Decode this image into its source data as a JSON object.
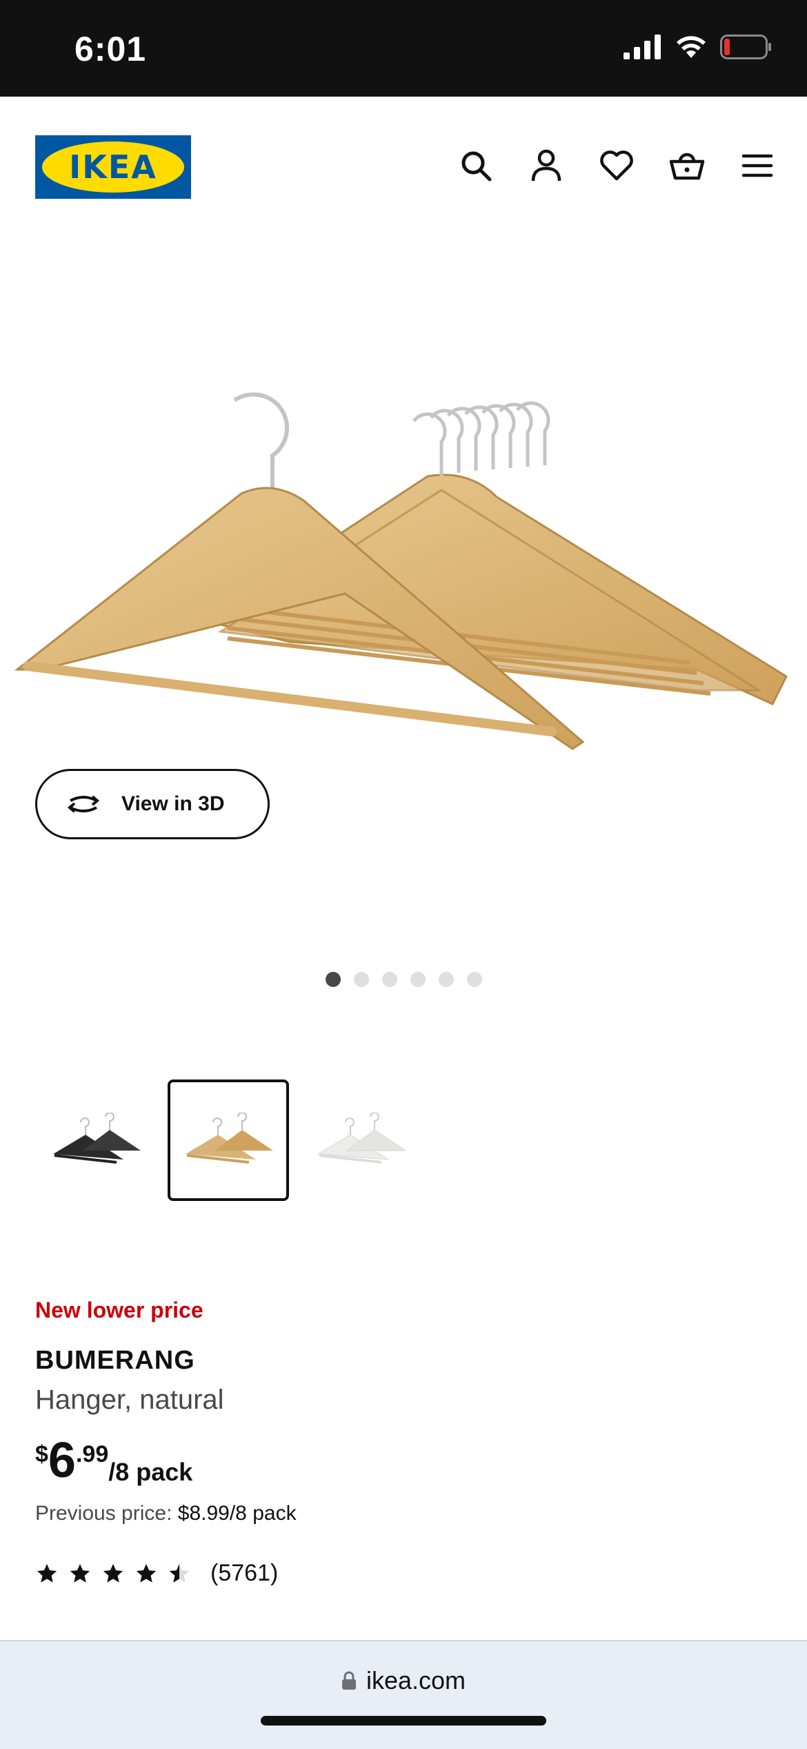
{
  "status_bar": {
    "time": "6:01",
    "icons": [
      "signal-icon",
      "wifi-icon",
      "battery-low-icon"
    ],
    "battery_color": "#e5332a"
  },
  "header": {
    "logo_text": "IKEA",
    "brand_colors": {
      "blue": "#0058a3",
      "yellow": "#ffdb00"
    },
    "icons": [
      "search-icon",
      "account-icon",
      "heart-icon",
      "basket-icon",
      "menu-icon"
    ]
  },
  "gallery": {
    "view_3d_label": "View in 3D",
    "dot_count": 6,
    "active_dot": 0,
    "thumbnails": [
      {
        "variant": "black"
      },
      {
        "variant": "natural",
        "selected": true
      },
      {
        "variant": "white"
      }
    ]
  },
  "product": {
    "promo_label": "New lower price",
    "name": "BUMERANG",
    "description": "Hanger, natural",
    "price": {
      "currency": "$",
      "whole": "6",
      "decimal": ".99",
      "unit": "/8 pack"
    },
    "previous_price_label": "Previous price:",
    "previous_price_value": "$8.99/8 pack",
    "rating": {
      "stars": 4.5,
      "count": "(5761)"
    },
    "promo_color": "#cc0008"
  },
  "browser": {
    "url": "ikea.com"
  }
}
